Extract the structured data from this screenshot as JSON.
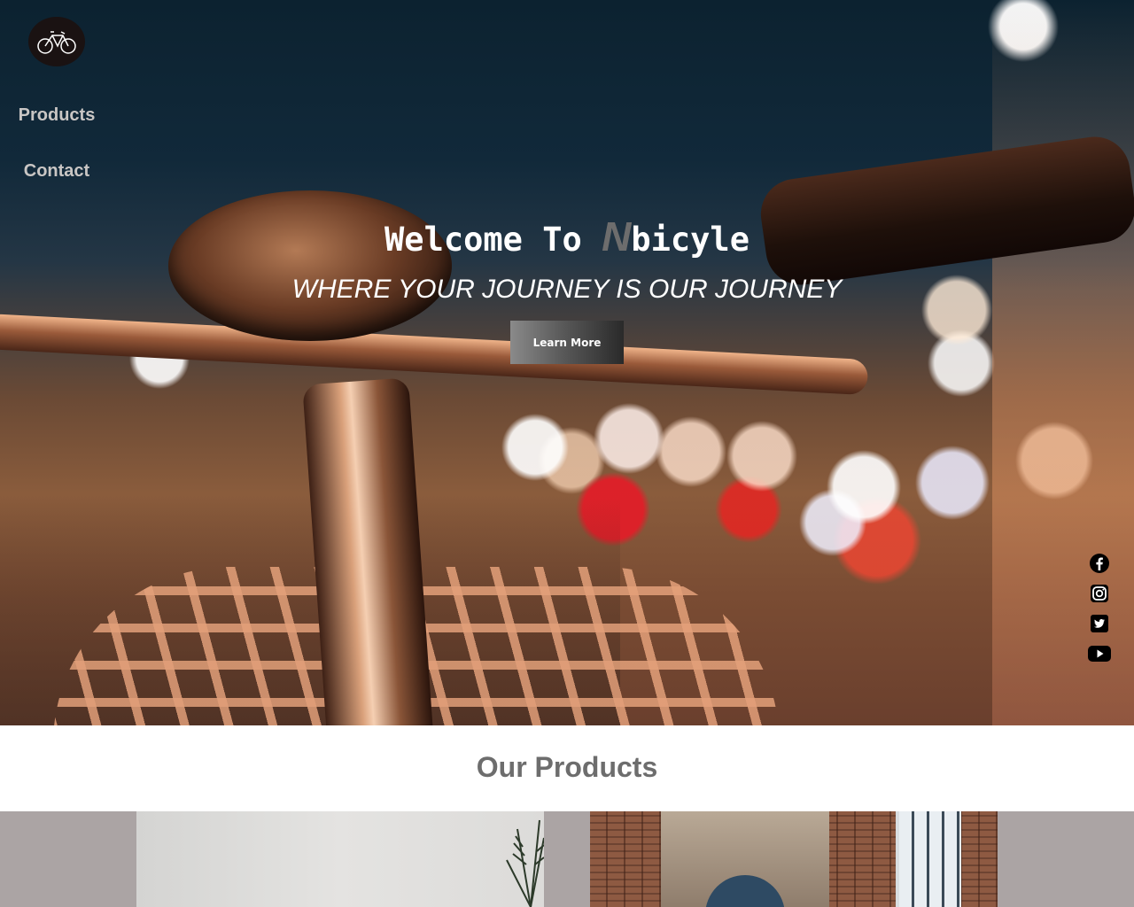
{
  "nav": {
    "logo_text": "Bicycle",
    "items": [
      {
        "label": "Products"
      },
      {
        "label": "Contact"
      }
    ]
  },
  "hero": {
    "title_prefix": "Welcome To ",
    "title_n": "N",
    "title_suffix": "bicyle",
    "tagline": "WHERE YOUR JOURNEY IS OUR JOURNEY",
    "cta_label": "Learn More"
  },
  "social": {
    "icons": [
      "facebook-icon",
      "instagram-icon",
      "twitter-icon",
      "youtube-icon"
    ]
  },
  "products": {
    "heading": "Our Products"
  },
  "colors": {
    "nav_text": "#c9c6c4",
    "heading_gray": "#6d6d6d",
    "band_gray": "#aba4a4"
  }
}
